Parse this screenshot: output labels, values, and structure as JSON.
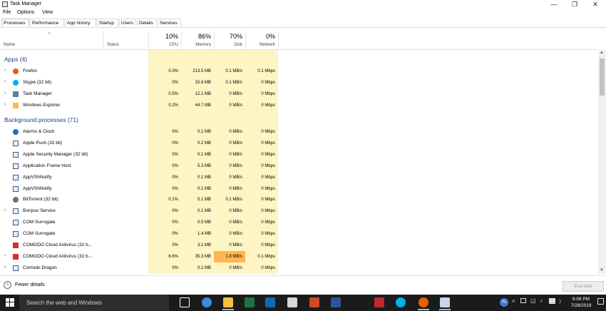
{
  "window": {
    "title": "Task Manager"
  },
  "menu": [
    "File",
    "Options",
    "View"
  ],
  "tabs": [
    "Processes",
    "Performance",
    "App history",
    "Startup",
    "Users",
    "Details",
    "Services"
  ],
  "columns": {
    "name": "Name",
    "status": "Status",
    "cpu": {
      "pct": "10%",
      "label": "CPU"
    },
    "memory": {
      "pct": "86%",
      "label": "Memory"
    },
    "disk": {
      "pct": "70%",
      "label": "Disk"
    },
    "network": {
      "pct": "0%",
      "label": "Network"
    }
  },
  "groups": {
    "apps": "Apps (4)",
    "background": "Background processes (71)"
  },
  "apps": [
    {
      "name": "Firefox",
      "cpu": "0.3%",
      "mem": "213.5 MB",
      "disk": "0.1 MB/s",
      "net": "0.1 Mbps",
      "icon": "firefox-icon",
      "color": "#e66000"
    },
    {
      "name": "Skype (32 bit)",
      "cpu": "0%",
      "mem": "15.8 MB",
      "disk": "0.1 MB/s",
      "net": "0 Mbps",
      "icon": "skype-icon",
      "color": "#00aff0"
    },
    {
      "name": "Task Manager",
      "cpu": "0.5%",
      "mem": "12.1 MB",
      "disk": "0 MB/s",
      "net": "0 Mbps",
      "icon": "task-manager-icon",
      "color": "#5a7fa5"
    },
    {
      "name": "Windows Explorer",
      "cpu": "0.2%",
      "mem": "44.7 MB",
      "disk": "0 MB/s",
      "net": "0 Mbps",
      "icon": "folder-icon",
      "color": "#f3c03e"
    }
  ],
  "background": [
    {
      "name": "Alarms & Clock",
      "cpu": "0%",
      "mem": "0.1 MB",
      "disk": "0 MB/s",
      "net": "0 Mbps",
      "icon": "clock-icon",
      "color": "#1e6fc1",
      "chev": false
    },
    {
      "name": "Apple Push (32 bit)",
      "cpu": "0%",
      "mem": "0.2 MB",
      "disk": "0 MB/s",
      "net": "0 Mbps",
      "icon": "app-window-icon",
      "color": "#3a5a8c",
      "chev": false
    },
    {
      "name": "Apple Security Manager (32 bit)",
      "cpu": "0%",
      "mem": "0.1 MB",
      "disk": "0 MB/s",
      "net": "0 Mbps",
      "icon": "app-window-icon",
      "color": "#3a5a8c",
      "chev": false
    },
    {
      "name": "Application Frame Host",
      "cpu": "0%",
      "mem": "5.3 MB",
      "disk": "0 MB/s",
      "net": "0 Mbps",
      "icon": "app-window-icon",
      "color": "#3a5a8c",
      "chev": false
    },
    {
      "name": "AppVShNotify",
      "cpu": "0%",
      "mem": "0.1 MB",
      "disk": "0 MB/s",
      "net": "0 Mbps",
      "icon": "app-window-icon",
      "color": "#3a5a8c",
      "chev": false
    },
    {
      "name": "AppVShNotify",
      "cpu": "0%",
      "mem": "0.1 MB",
      "disk": "0 MB/s",
      "net": "0 Mbps",
      "icon": "app-window-icon",
      "color": "#3a5a8c",
      "chev": false
    },
    {
      "name": "BitTorrent (32 bit)",
      "cpu": "0.1%",
      "mem": "5.1 MB",
      "disk": "0.1 MB/s",
      "net": "0 Mbps",
      "icon": "bittorrent-icon",
      "color": "#6e6e6e",
      "chev": false
    },
    {
      "name": "Bonjour Service",
      "cpu": "0%",
      "mem": "0.1 MB",
      "disk": "0 MB/s",
      "net": "0 Mbps",
      "icon": "app-window-icon",
      "color": "#3a5a8c",
      "chev": true
    },
    {
      "name": "COM Surrogate",
      "cpu": "0%",
      "mem": "0.5 MB",
      "disk": "0 MB/s",
      "net": "0 Mbps",
      "icon": "app-window-icon",
      "color": "#3a5a8c",
      "chev": false
    },
    {
      "name": "COM Surrogate",
      "cpu": "0%",
      "mem": "1.4 MB",
      "disk": "0 MB/s",
      "net": "0 Mbps",
      "icon": "app-window-icon",
      "color": "#3a5a8c",
      "chev": false
    },
    {
      "name": "COMODO Cloud Antivirus (32 b...",
      "cpu": "0%",
      "mem": "3.1 MB",
      "disk": "0 MB/s",
      "net": "0 Mbps",
      "icon": "comodo-icon",
      "color": "#d32f2f",
      "chev": false
    },
    {
      "name": "COMODO Cloud Antivirus (32 b...",
      "cpu": "6.6%",
      "mem": "35.3 MB",
      "disk": "1.8 MB/s",
      "net": "0.1 Mbps",
      "icon": "comodo-icon",
      "color": "#d32f2f",
      "chev": true,
      "hot": true
    },
    {
      "name": "Comodo Dragon",
      "cpu": "0%",
      "mem": "0.1 MB",
      "disk": "0 MB/s",
      "net": "0 Mbps",
      "icon": "app-window-icon",
      "color": "#3a5a8c",
      "chev": true
    }
  ],
  "footer": {
    "fewer": "Fewer details",
    "endtask": "End task"
  },
  "taskbar": {
    "search": "Search the web and Windows",
    "time": "6:06 PM",
    "date": "7/28/2019",
    "icons": [
      {
        "name": "task-view-icon",
        "color": "#ffffff"
      },
      {
        "name": "edge-icon",
        "color": "#3b8bd9"
      },
      {
        "name": "file-explorer-icon",
        "color": "#f3c03e"
      },
      {
        "name": "excel-icon",
        "color": "#1f7244"
      },
      {
        "name": "outlook-icon",
        "color": "#0f6ab4"
      },
      {
        "name": "calculator-icon",
        "color": "#d8d8d8"
      },
      {
        "name": "powerpoint-icon",
        "color": "#d24726"
      },
      {
        "name": "word-icon",
        "color": "#2b579a"
      },
      {
        "name": "acrobat-icon",
        "color": "#c1272d"
      },
      {
        "name": "skype-icon",
        "color": "#00aff0"
      },
      {
        "name": "firefox-icon",
        "color": "#e66000"
      },
      {
        "name": "task-manager-icon",
        "color": "#c9d6e4"
      }
    ]
  },
  "colors": {
    "shade": "#fff4c4",
    "hot": "#ffb554",
    "group_text": "#1e3f7a"
  }
}
